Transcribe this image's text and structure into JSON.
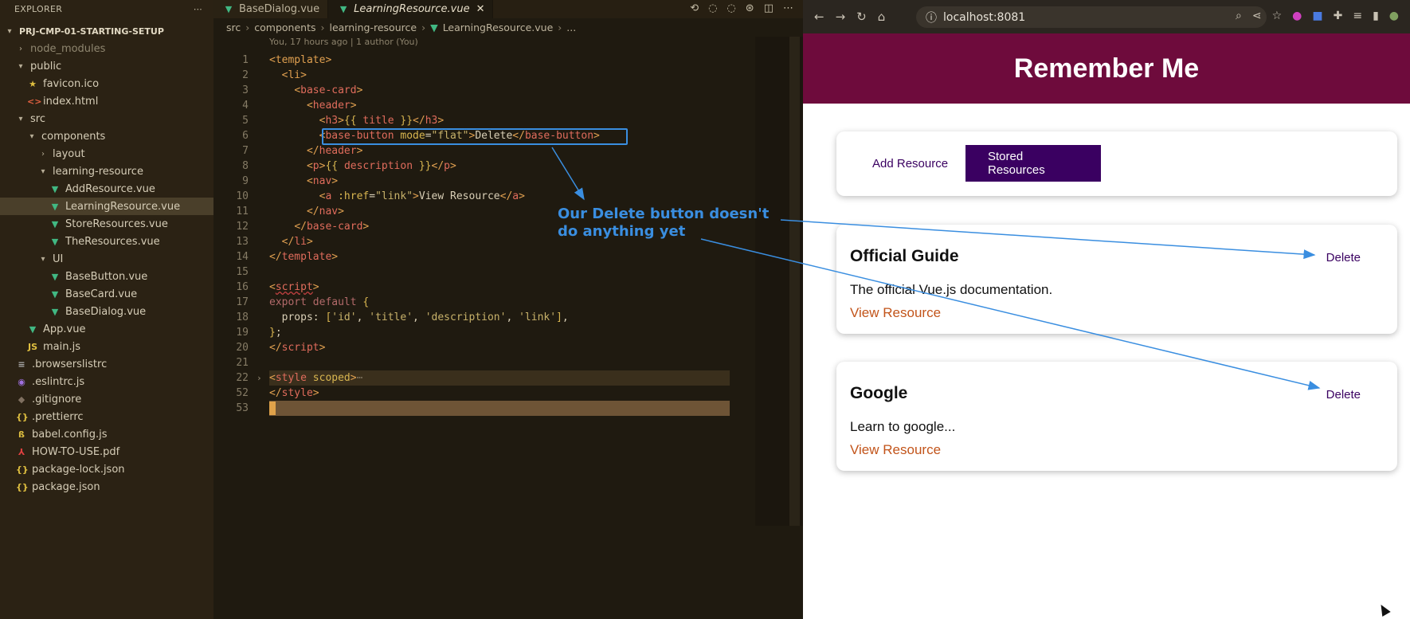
{
  "sidebar": {
    "title": "EXPLORER",
    "more_icon": "ellipsis-icon",
    "project": "PRJ-CMP-01-STARTING-SETUP",
    "tree": [
      {
        "label": "node_modules",
        "indent": 1,
        "kind": "folder",
        "open": false,
        "dim": true
      },
      {
        "label": "public",
        "indent": 1,
        "kind": "folder",
        "open": true
      },
      {
        "label": "favicon.ico",
        "indent": 2,
        "kind": "star",
        "color": "#e0c040"
      },
      {
        "label": "index.html",
        "indent": 2,
        "kind": "html",
        "color": "#e06040"
      },
      {
        "label": "src",
        "indent": 1,
        "kind": "folder",
        "open": true
      },
      {
        "label": "components",
        "indent": 2,
        "kind": "folder",
        "open": true
      },
      {
        "label": "layout",
        "indent": 3,
        "kind": "folder",
        "open": false
      },
      {
        "label": "learning-resource",
        "indent": 3,
        "kind": "folder",
        "open": true
      },
      {
        "label": "AddResource.vue",
        "indent": 4,
        "kind": "vue",
        "color": "#41b883"
      },
      {
        "label": "LearningResource.vue",
        "indent": 4,
        "kind": "vue",
        "color": "#41b883",
        "selected": true
      },
      {
        "label": "StoreResources.vue",
        "indent": 4,
        "kind": "vue",
        "color": "#41b883"
      },
      {
        "label": "TheResources.vue",
        "indent": 4,
        "kind": "vue",
        "color": "#41b883"
      },
      {
        "label": "UI",
        "indent": 3,
        "kind": "folder",
        "open": true
      },
      {
        "label": "BaseButton.vue",
        "indent": 4,
        "kind": "vue",
        "color": "#41b883"
      },
      {
        "label": "BaseCard.vue",
        "indent": 4,
        "kind": "vue",
        "color": "#41b883"
      },
      {
        "label": "BaseDialog.vue",
        "indent": 4,
        "kind": "vue",
        "color": "#41b883"
      },
      {
        "label": "App.vue",
        "indent": 2,
        "kind": "vue",
        "color": "#41b883"
      },
      {
        "label": "main.js",
        "indent": 2,
        "kind": "js",
        "color": "#e0c040"
      },
      {
        "label": ".browserslistrc",
        "indent": 1,
        "kind": "lines",
        "color": "#aaaaaa"
      },
      {
        "label": ".eslintrc.js",
        "indent": 1,
        "kind": "eslint",
        "color": "#a070e0"
      },
      {
        "label": ".gitignore",
        "indent": 1,
        "kind": "git",
        "color": "#807060"
      },
      {
        "label": ".prettierrc",
        "indent": 1,
        "kind": "json",
        "color": "#e0c040"
      },
      {
        "label": "babel.config.js",
        "indent": 1,
        "kind": "babel",
        "color": "#e0c040"
      },
      {
        "label": "HOW-TO-USE.pdf",
        "indent": 1,
        "kind": "pdf",
        "color": "#e04040"
      },
      {
        "label": "package-lock.json",
        "indent": 1,
        "kind": "json",
        "color": "#e0c040"
      },
      {
        "label": "package.json",
        "indent": 1,
        "kind": "json",
        "color": "#e0c040"
      }
    ]
  },
  "editor": {
    "tabs": [
      {
        "label": "BaseDialog.vue",
        "active": false
      },
      {
        "label": "LearningResource.vue",
        "active": true
      }
    ],
    "breadcrumb": [
      "src",
      "components",
      "learning-resource",
      "LearningResource.vue",
      "..."
    ],
    "blame": "You, 17 hours ago | 1 author (You)",
    "lines": [
      {
        "n": "1",
        "html": "<span class='t'>&lt;template&gt;</span>"
      },
      {
        "n": "2",
        "html": "  <span class='t'>&lt;li&gt;</span>"
      },
      {
        "n": "3",
        "html": "    <span class='t'>&lt;</span><span class='tn'>base-card</span><span class='t'>&gt;</span>"
      },
      {
        "n": "4",
        "html": "      <span class='t'>&lt;</span><span class='tn'>header</span><span class='t'>&gt;</span>"
      },
      {
        "n": "5",
        "html": "        <span class='t'>&lt;</span><span class='tn'>h3</span><span class='t'>&gt;</span><span class='a'>{{</span> <span class='tn'>title</span> <span class='a'>}}</span><span class='t'>&lt;/</span><span class='tn'>h3</span><span class='t'>&gt;</span>"
      },
      {
        "n": "6",
        "html": "        <span class='t'>&lt;</span><span class='tn'>base-button</span> <span class='a'>mode</span><span class='w'>=</span><span class='s'>\"flat\"</span><span class='t'>&gt;</span><span class='w'>Delete</span><span class='t'>&lt;/</span><span class='tn'>base-button</span><span class='t'>&gt;</span>"
      },
      {
        "n": "7",
        "html": "      <span class='t'>&lt;/</span><span class='tn'>header</span><span class='t'>&gt;</span>"
      },
      {
        "n": "8",
        "html": "      <span class='t'>&lt;</span><span class='tn'>p</span><span class='t'>&gt;</span><span class='a'>{{</span> <span class='tn'>description</span> <span class='a'>}}</span><span class='t'>&lt;/</span><span class='tn'>p</span><span class='t'>&gt;</span>"
      },
      {
        "n": "9",
        "html": "      <span class='t'>&lt;</span><span class='tn'>nav</span><span class='t'>&gt;</span>"
      },
      {
        "n": "10",
        "html": "        <span class='t'>&lt;</span><span class='tn'>a</span> <span class='a'>:href</span><span class='w'>=</span><span class='s'>\"link\"</span><span class='t'>&gt;</span><span class='w'>View Resource</span><span class='t'>&lt;/</span><span class='tn'>a</span><span class='t'>&gt;</span>"
      },
      {
        "n": "11",
        "html": "      <span class='t'>&lt;/</span><span class='tn'>nav</span><span class='t'>&gt;</span>"
      },
      {
        "n": "12",
        "html": "    <span class='t'>&lt;/</span><span class='tn'>base-card</span><span class='t'>&gt;</span>"
      },
      {
        "n": "13",
        "html": "  <span class='t'>&lt;/</span><span class='tn'>li</span><span class='t'>&gt;</span>"
      },
      {
        "n": "14",
        "html": "<span class='t'>&lt;/</span><span class='tn'>template</span><span class='t'>&gt;</span>"
      },
      {
        "n": "15",
        "html": ""
      },
      {
        "n": "16",
        "html": "<span class='t'>&lt;</span><span class='tn' style='text-decoration:underline wavy #c04040'>script</span><span class='t'>&gt;</span>"
      },
      {
        "n": "17",
        "html": "<span class='k'>export default</span> <span class='a'>{</span>"
      },
      {
        "n": "18",
        "html": "  <span class='w'>props:</span> <span class='a'>[</span><span class='s'>'id'</span><span class='w'>,</span> <span class='s'>'title'</span><span class='w'>,</span> <span class='s'>'description'</span><span class='w'>,</span> <span class='s'>'link'</span><span class='a'>]</span><span class='w'>,</span>"
      },
      {
        "n": "19",
        "html": "<span class='a'>}</span><span class='w'>;</span>"
      },
      {
        "n": "20",
        "html": "<span class='t'>&lt;/</span><span class='tn'>script</span><span class='t'>&gt;</span>"
      },
      {
        "n": "21",
        "html": ""
      },
      {
        "n": "22",
        "html": "<span class='t'>&lt;</span><span class='tn'>style</span> <span class='a'>scoped</span><span class='t'>&gt;</span><span class='cm'>⋯</span>",
        "fold": true,
        "hl": "fold"
      },
      {
        "n": "52",
        "html": "<span class='t'>&lt;/</span><span class='tn'>style</span><span class='t'>&gt;</span>"
      },
      {
        "n": "53",
        "html": "",
        "hl": "cursor"
      }
    ],
    "annotation": "Our Delete button doesn't do anything yet"
  },
  "browser": {
    "url": "localhost:8081",
    "banner_title": "Remember Me",
    "nav": {
      "add": "Add Resource",
      "stored": "Stored Resources"
    },
    "resources": [
      {
        "title": "Official Guide",
        "description": "The official Vue.js documentation.",
        "link": "View Resource",
        "delete": "Delete"
      },
      {
        "title": "Google",
        "description": "Learn to google...",
        "link": "View Resource",
        "delete": "Delete"
      }
    ],
    "colors": {
      "banner": "#6e0b3c",
      "accent": "#3a0061",
      "link": "#c2541a"
    }
  }
}
